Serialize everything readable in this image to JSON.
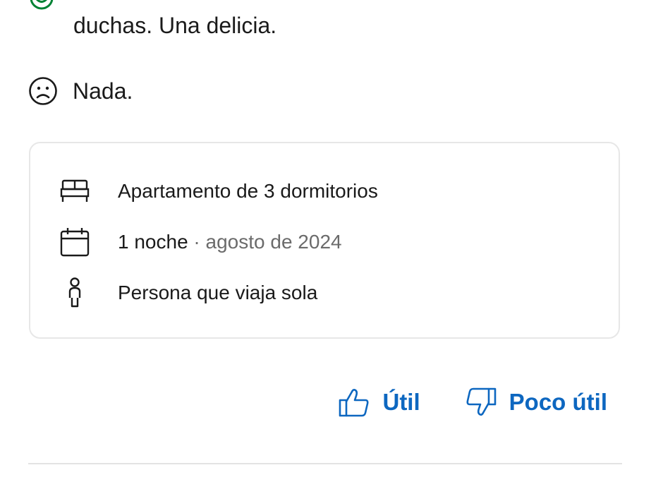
{
  "review": {
    "positive_text": "duchas. Una delicia.",
    "negative_text": "Nada."
  },
  "stay_details": {
    "room": "Apartamento de 3 dormitorios",
    "nights": "1 noche",
    "separator": " · ",
    "date": "agosto de 2024",
    "traveler_type": "Persona que viaja sola"
  },
  "actions": {
    "helpful_label": "Útil",
    "not_helpful_label": "Poco útil"
  },
  "icons": {
    "positive": "smile-icon",
    "negative": "sad-face-icon",
    "room": "bed-icon",
    "stay": "calendar-icon",
    "traveler": "person-icon",
    "helpful": "thumbs-up-icon",
    "not_helpful": "thumbs-down-icon"
  },
  "colors": {
    "accent": "#0d67c0",
    "positive": "#008234",
    "text": "#1a1a1a",
    "muted": "#6b6b6b",
    "border": "#e7e7e7"
  }
}
